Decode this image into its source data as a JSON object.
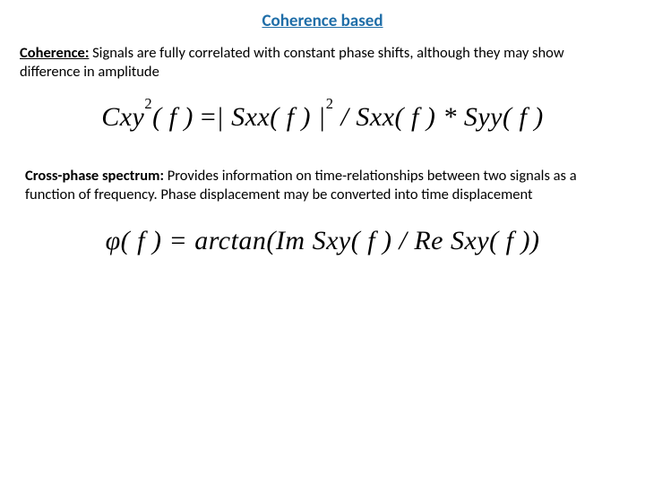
{
  "title": "Coherence based",
  "section1": {
    "term": "Coherence:",
    "body": " Signals are fully correlated with constant phase shifts, although they may show difference in amplitude"
  },
  "formula1": "Cxy²( f ) = | Sxx( f ) |² / Sxx( f ) * Syy( f )",
  "section2": {
    "term": "Cross-phase spectrum:",
    "body": "  Provides information on time-relationships between two signals as a function of frequency.  Phase displacement may be converted into time displacement"
  },
  "formula2": "φ( f ) = arctan(Im Sxy( f ) / Re Sxy( f ))"
}
